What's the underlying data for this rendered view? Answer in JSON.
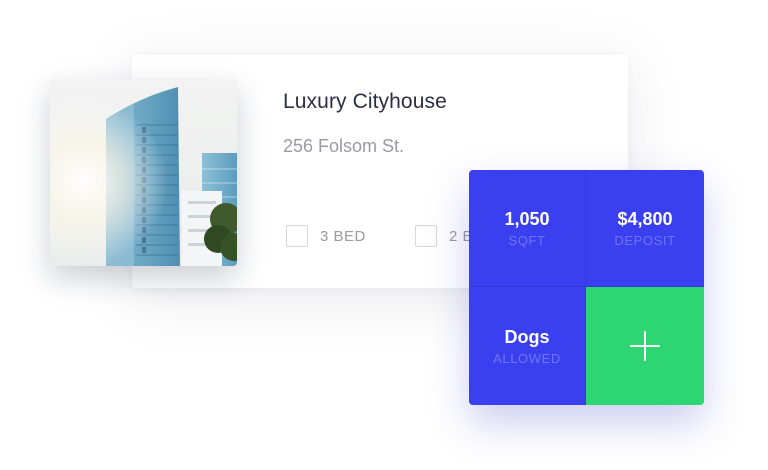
{
  "listing": {
    "title": "Luxury Cityhouse",
    "address": "256 Folsom St.",
    "photo_icon": "building-photo"
  },
  "features": [
    {
      "label": "3 BED"
    },
    {
      "label": "2 B"
    }
  ],
  "stats": {
    "sqft_value": "1,050",
    "sqft_label": "SQFT",
    "deposit_value": "$4,800",
    "deposit_label": "DEPOSIT",
    "pets_value": "Dogs",
    "pets_label": "ALLOWED",
    "add_icon": "plus-icon"
  },
  "colors": {
    "tile_blue": "#3a3ff0",
    "tile_green": "#2ed573",
    "title_text": "#2b2f44",
    "muted_text": "#9a9aa3"
  }
}
